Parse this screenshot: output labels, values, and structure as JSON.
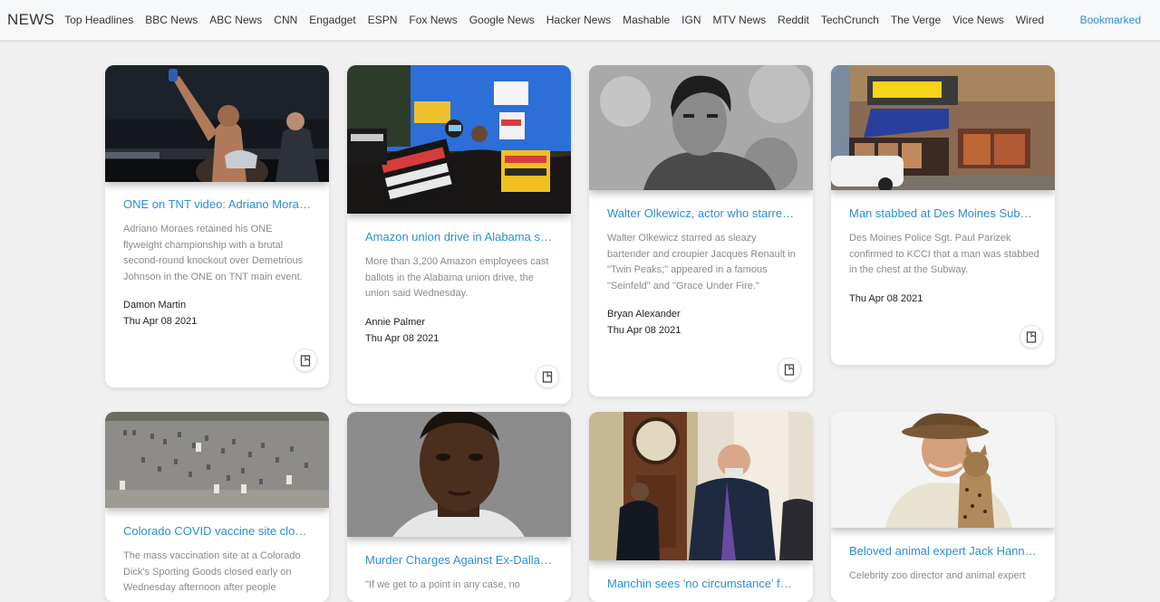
{
  "header": {
    "brand": "NEWS",
    "nav": [
      "Top Headlines",
      "BBC News",
      "ABC News",
      "CNN",
      "Engadget",
      "ESPN",
      "Fox News",
      "Google News",
      "Hacker News",
      "Mashable",
      "IGN",
      "MTV News",
      "Reddit",
      "TechCrunch",
      "The Verge",
      "Vice News",
      "Wired"
    ],
    "bookmarked": "Bookmarked"
  },
  "colors": {
    "accent": "#2a8fd6",
    "background": "#f0f0f0",
    "card": "#ffffff",
    "muted_text": "#8a8a8a"
  },
  "cards": [
    {
      "title": "ONE on TNT video: Adriano Moraes knocks out Demetrious Johnson",
      "description": "Adriano Moraes retained his ONE flyweight championship with a brutal second-round knockout over Demetrious Johnson in the ONE on TNT main event.",
      "author": "Damon Martin",
      "date": "Thu Apr 08 2021",
      "image": "fighter-celebrating-photo",
      "bookmark_icon": "bookmark-icon"
    },
    {
      "title": "Amazon union drive in Alabama shows sign of faltering",
      "description": "More than 3,200 Amazon employees cast ballots in the Alabama union drive, the union said Wednesday.",
      "author": "Annie Palmer",
      "date": "Thu Apr 08 2021",
      "image": "union-protest-photo",
      "bookmark_icon": "bookmark-icon"
    },
    {
      "title": "Walter Olkewicz, actor who starred in 'Twin Peaks,' dies",
      "description": "Walter Olkewicz starred as sleazy bartender and croupier Jacques Renault in \"Twin Peaks;\" appeared in a famous \"Seinfeld\" and \"Grace Under Fire.\"",
      "author": "Bryan Alexander",
      "date": "Thu Apr 08 2021",
      "image": "actor-portrait-photo",
      "bookmark_icon": "bookmark-icon"
    },
    {
      "title": "Man stabbed at Des Moines Subway restaurant",
      "description": "Des Moines Police Sgt. Paul Parizek confirmed to KCCI that a man was stabbed in the chest at the Subway.",
      "author": "",
      "date": "Thu Apr 08 2021",
      "image": "subway-storefront-photo",
      "bookmark_icon": "bookmark-icon"
    },
    {
      "title": "Colorado COVID vaccine site closes early after people",
      "description": "The mass vaccination site at a Colorado Dick's Sporting Goods closed early on Wednesday afternoon after people",
      "author": "",
      "date": "",
      "image": "aerial-parking-lot-photo",
      "bookmark_icon": "bookmark-icon"
    },
    {
      "title": "Murder Charges Against Ex-Dallas Officer",
      "description": "\"If we get to a point in any case, no",
      "author": "",
      "date": "",
      "image": "mugshot-photo",
      "bookmark_icon": "bookmark-icon"
    },
    {
      "title": "Manchin sees 'no circumstance' for ending filibuster",
      "description": "",
      "author": "",
      "date": "",
      "image": "senator-hallway-photo",
      "bookmark_icon": "bookmark-icon"
    },
    {
      "title": "Beloved animal expert Jack Hanna diagnosed with dementia",
      "description": "Celebrity zoo director and animal expert",
      "author": "",
      "date": "",
      "image": "zookeeper-with-cat-photo",
      "bookmark_icon": "bookmark-icon"
    }
  ]
}
